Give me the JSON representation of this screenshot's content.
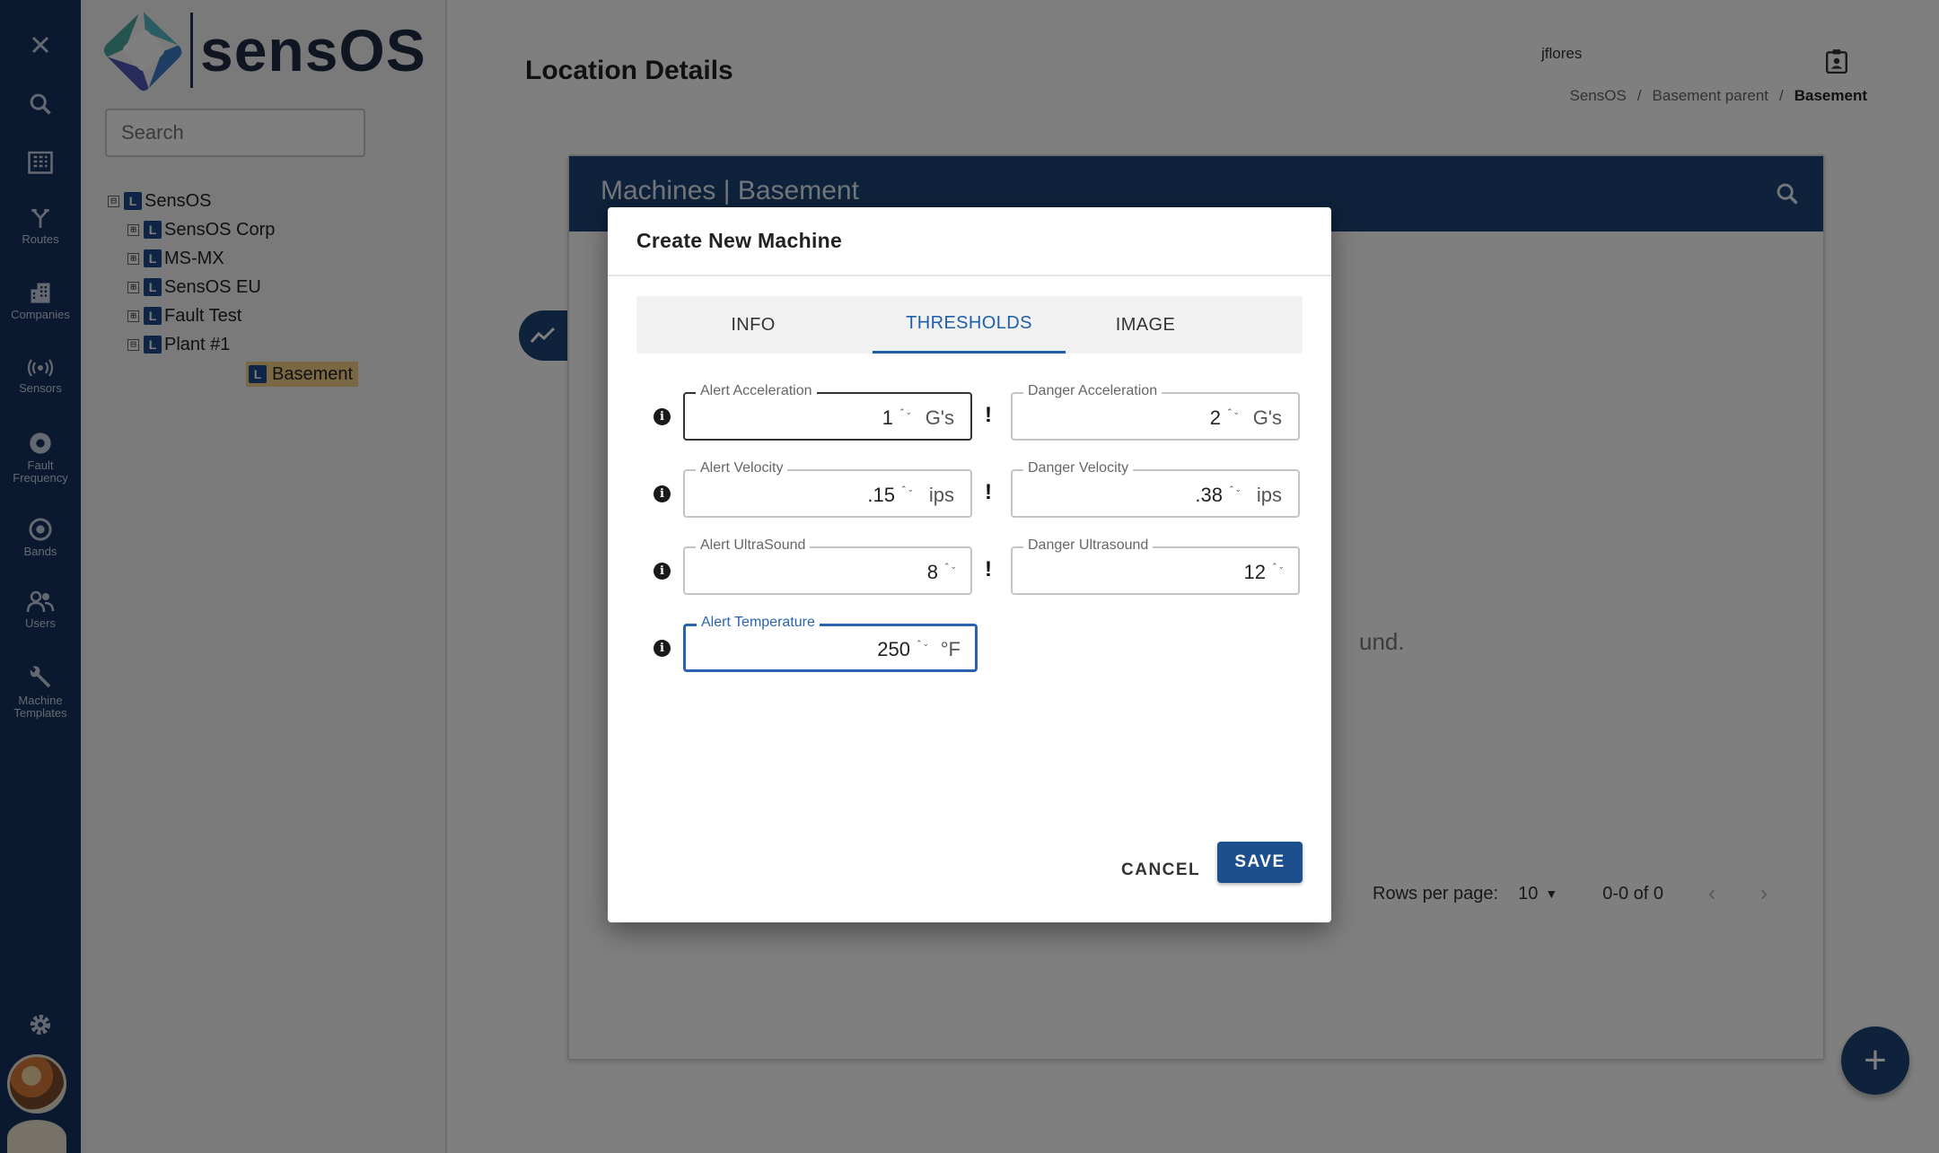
{
  "sidebar": {
    "close_icon": "close-icon",
    "items": [
      {
        "icon": "search-icon",
        "label": ""
      },
      {
        "icon": "building-icon",
        "label": ""
      },
      {
        "icon": "routes-icon",
        "label": "Routes"
      },
      {
        "icon": "companies-icon",
        "label": "Companies"
      },
      {
        "icon": "sensors-icon",
        "label": "Sensors"
      },
      {
        "icon": "fault-frequency-icon",
        "label": "Fault Frequency"
      },
      {
        "icon": "bands-icon",
        "label": "Bands"
      },
      {
        "icon": "users-icon",
        "label": "Users"
      },
      {
        "icon": "wrench-icon",
        "label": "Machine Templates"
      }
    ],
    "settings_icon": "gear-icon"
  },
  "brand": {
    "name": "sensOS"
  },
  "tree": {
    "search_placeholder": "Search",
    "nodes": [
      {
        "label": "SensOS",
        "toggle": "⊟",
        "badge": "L"
      },
      {
        "label": "SensOS Corp",
        "toggle": "⊞",
        "badge": "L"
      },
      {
        "label": "MS-MX",
        "toggle": "⊞",
        "badge": "L"
      },
      {
        "label": "SensOS EU",
        "toggle": "⊞",
        "badge": "L"
      },
      {
        "label": "Fault Test",
        "toggle": "⊞",
        "badge": "L"
      },
      {
        "label": "Plant #1",
        "toggle": "⊟",
        "badge": "L"
      },
      {
        "label": "Basement",
        "toggle": "",
        "badge": "L",
        "selected": true
      }
    ]
  },
  "header": {
    "title": "Location Details",
    "user": "jflores",
    "breadcrumb": [
      "SensOS",
      "Basement parent",
      "Basement"
    ],
    "breadcrumb_separator": "/"
  },
  "card": {
    "title": "Machines | Basement",
    "empty_text_fragment": "und.",
    "pagination": {
      "rows_per_page_label": "Rows per page:",
      "rows_per_page_value": "10",
      "range": "0-0 of 0",
      "prev": "‹",
      "next": "›"
    }
  },
  "fab": {
    "label": "+"
  },
  "dialog": {
    "title": "Create New Machine",
    "tabs": [
      "INFO",
      "THRESHOLDS",
      "IMAGE"
    ],
    "active_tab": "THRESHOLDS",
    "fields": {
      "alert_acceleration": {
        "label": "Alert Acceleration",
        "value": "1",
        "unit": "G's"
      },
      "danger_acceleration": {
        "label": "Danger Acceleration",
        "value": "2",
        "unit": "G's"
      },
      "alert_velocity": {
        "label": "Alert Velocity",
        "value": ".15",
        "unit": "ips"
      },
      "danger_velocity": {
        "label": "Danger Velocity",
        "value": ".38",
        "unit": "ips"
      },
      "alert_ultrasound": {
        "label": "Alert UltraSound",
        "value": "8",
        "unit": ""
      },
      "danger_ultrasound": {
        "label": "Danger Ultrasound",
        "value": "12",
        "unit": ""
      },
      "alert_temperature": {
        "label": "Alert Temperature",
        "value": "250",
        "unit": "°F"
      }
    },
    "info_glyph": "i",
    "warning_glyph": "!",
    "spinner_glyph": "⌃⌄",
    "cancel_label": "CANCEL",
    "save_label": "SAVE"
  },
  "colors": {
    "rail": "#15335f",
    "card_header": "#1d4577",
    "accent": "#1f5fa8",
    "save_button": "#1d4f8f",
    "selected_node": "#f5d08a"
  }
}
